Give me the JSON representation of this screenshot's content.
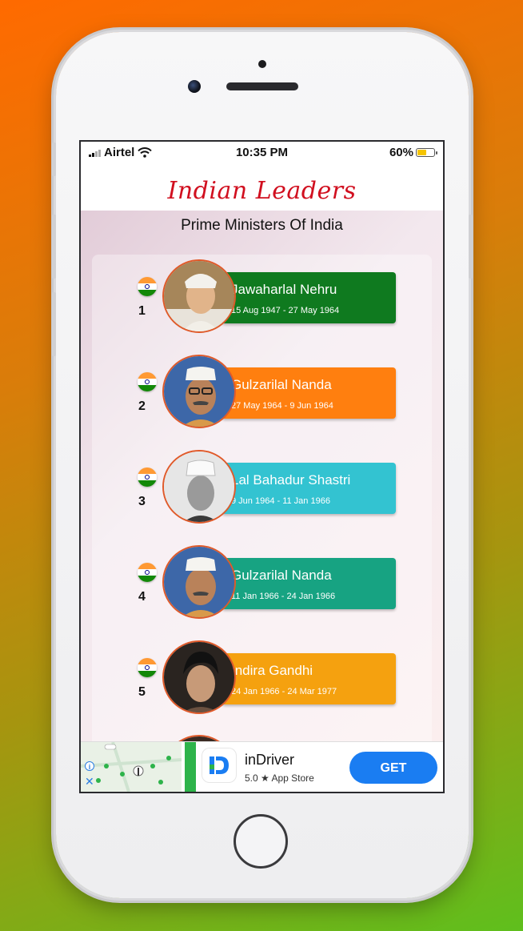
{
  "status_bar": {
    "carrier": "Airtel",
    "time": "10:35 PM",
    "battery": "60%",
    "battery_level": 0.6
  },
  "app": {
    "title": "Indian Leaders",
    "subtitle": "Prime Ministers Of India"
  },
  "leaders": [
    {
      "number": "1",
      "name": "Jawaharlal Nehru",
      "dates": "15 Aug 1947  -  27 May 1964",
      "color": "#0f7a1f"
    },
    {
      "number": "2",
      "name": "Gulzarilal Nanda",
      "dates": "27 May 1964  -  9 Jun 1964",
      "color": "#ff7f0f"
    },
    {
      "number": "3",
      "name": "Lal Bahadur Shastri",
      "dates": "9 Jun 1964  -  11 Jan 1966",
      "color": "#33c3d1"
    },
    {
      "number": "4",
      "name": "Gulzarilal Nanda",
      "dates": "11 Jan 1966  -  24 Jan 1966",
      "color": "#17a382"
    },
    {
      "number": "5",
      "name": "Indira Gandhi",
      "dates": "24 Jan 1966  -  24 Mar 1977",
      "color": "#f5a10f"
    }
  ],
  "ad": {
    "app_name": "inDriver",
    "rating": "5.0 ★ App Store",
    "cta": "GET"
  }
}
